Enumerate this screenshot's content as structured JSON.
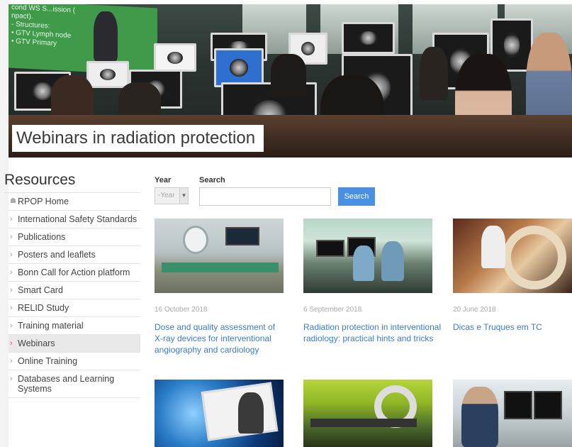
{
  "hero": {
    "title": "Webinars in radiation protection",
    "slide_lines": [
      "cond WS S...ission (",
      "npact).",
      "- Structures:",
      "• GTV Lymph node",
      "• GTV Primary"
    ]
  },
  "sidebar": {
    "heading": "Resources",
    "items": [
      {
        "label": "RPOP Home",
        "icon": "home-icon"
      },
      {
        "label": "International Safety Standards",
        "icon": "chevron-right-icon"
      },
      {
        "label": "Publications",
        "icon": "chevron-right-icon"
      },
      {
        "label": "Posters and leaflets",
        "icon": "chevron-right-icon"
      },
      {
        "label": "Bonn Call for Action platform",
        "icon": "chevron-right-icon"
      },
      {
        "label": "Smart Card",
        "icon": "chevron-right-icon"
      },
      {
        "label": "RELID Study",
        "icon": "chevron-right-icon"
      },
      {
        "label": "Training material",
        "icon": "chevron-right-icon"
      },
      {
        "label": "Webinars",
        "icon": "chevron-right-icon",
        "active": true
      },
      {
        "label": "Online Training",
        "icon": "chevron-right-icon"
      },
      {
        "label": "Databases and Learning Systems",
        "icon": "chevron-right-icon"
      }
    ]
  },
  "filter": {
    "year_label": "Year",
    "year_value": "-Year",
    "search_label": "Search",
    "search_value": "",
    "search_button": "Search"
  },
  "cards": [
    {
      "date": "16 October 2018",
      "title": "Dose and quality assessment of X-ray devices for interventional angiography and cardiology"
    },
    {
      "date": "6 September 2018",
      "title": "Radiation protection in interventional radiology: practical hints and tricks"
    },
    {
      "date": "20 June 2018",
      "title": "Dicas e Truques em TC"
    },
    {
      "date": "",
      "title": ""
    },
    {
      "date": "",
      "title": ""
    },
    {
      "date": "",
      "title": ""
    }
  ],
  "colors": {
    "link": "#3a7dc9",
    "button": "#4a90e2",
    "active_chevron": "#d9534f"
  }
}
